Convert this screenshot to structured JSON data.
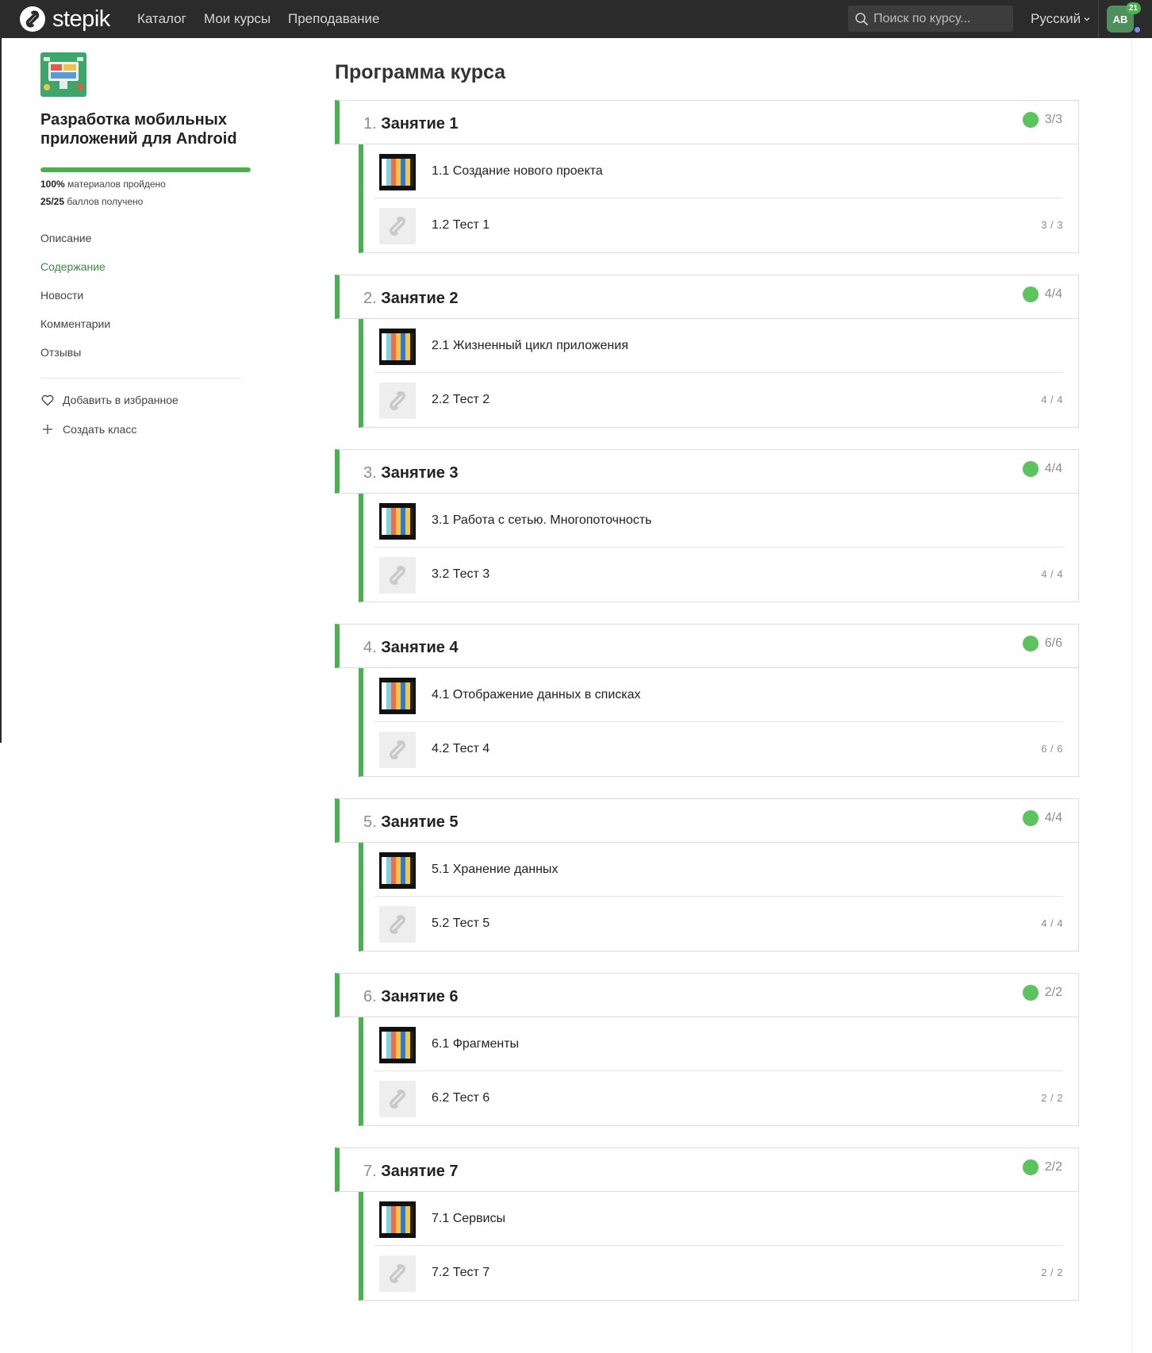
{
  "navbar": {
    "logo_text": "stepik",
    "links": [
      "Каталог",
      "Мои курсы",
      "Преподавание"
    ],
    "search_placeholder": "Поиск по курсу...",
    "language": "Русский",
    "avatar_initials": "AB",
    "notifications_count": "21",
    "icons": [
      "stepik-logo-icon",
      "search-icon",
      "chevron-down-icon"
    ]
  },
  "sidebar": {
    "course_title": "Разработка мобильных приложений для Android",
    "progress": {
      "percent_value": 100,
      "materials_value": "100%",
      "materials_label": "материалов пройдено",
      "points_value": "25/25",
      "points_label": "баллов получено"
    },
    "nav": [
      "Описание",
      "Содержание",
      "Новости",
      "Комментарии",
      "Отзывы"
    ],
    "active_nav": "Содержание",
    "actions": {
      "favorite": "Добавить в избранное",
      "create_class": "Создать класс"
    }
  },
  "main": {
    "title": "Программа курса",
    "lessons": [
      {
        "num": "1.",
        "title": "Занятие 1",
        "score": "3/3",
        "steps": [
          {
            "label": "1.1 Создание нового проекта",
            "score": ""
          },
          {
            "label": "1.2 Тест 1",
            "score": "3 / 3"
          }
        ]
      },
      {
        "num": "2.",
        "title": "Занятие 2",
        "score": "4/4",
        "steps": [
          {
            "label": "2.1 Жизненный цикл приложения",
            "score": ""
          },
          {
            "label": "2.2 Тест 2",
            "score": "4 / 4"
          }
        ]
      },
      {
        "num": "3.",
        "title": "Занятие 3",
        "score": "4/4",
        "steps": [
          {
            "label": "3.1 Работа с сетью. Многопоточность",
            "score": ""
          },
          {
            "label": "3.2 Тест 3",
            "score": "4 / 4"
          }
        ]
      },
      {
        "num": "4.",
        "title": "Занятие 4",
        "score": "6/6",
        "steps": [
          {
            "label": "4.1 Отображение данных в списках",
            "score": ""
          },
          {
            "label": "4.2 Тест 4",
            "score": "6 / 6"
          }
        ]
      },
      {
        "num": "5.",
        "title": "Занятие 5",
        "score": "4/4",
        "steps": [
          {
            "label": "5.1 Хранение данных",
            "score": ""
          },
          {
            "label": "5.2 Тест 5",
            "score": "4 / 4"
          }
        ]
      },
      {
        "num": "6.",
        "title": "Занятие 6",
        "score": "2/2",
        "steps": [
          {
            "label": "6.1 Фрагменты",
            "score": ""
          },
          {
            "label": "6.2 Тест 6",
            "score": "2 / 2"
          }
        ]
      },
      {
        "num": "7.",
        "title": "Занятие 7",
        "score": "2/2",
        "steps": [
          {
            "label": "7.1 Сервисы",
            "score": ""
          },
          {
            "label": "7.2 Тест 7",
            "score": "2 / 2"
          }
        ]
      }
    ]
  },
  "colors": {
    "accent": "#4caf50",
    "navbar": "#2b2b2b",
    "active_link": "#3a8a3f",
    "avatar": "#4f8f5d"
  }
}
